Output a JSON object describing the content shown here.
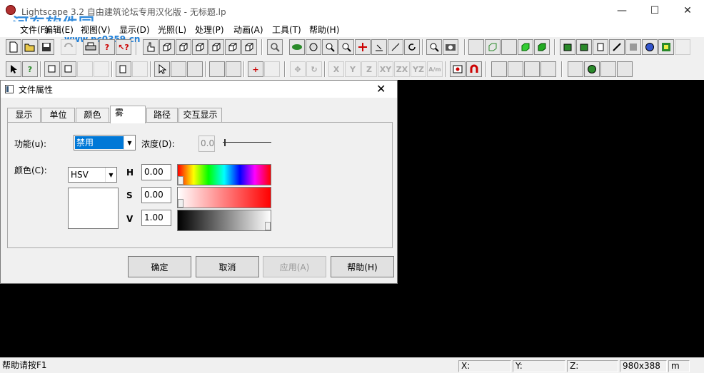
{
  "window": {
    "title": "Lightscape 3.2 自由建筑论坛专用汉化版  - 无标题.lp",
    "watermark": "河东软件园",
    "watermark_url": "www.pc0359.cn",
    "minimize": "—",
    "maximize": "☐",
    "close": "✕"
  },
  "menubar": [
    "文件(F)",
    "编辑(E)",
    "视图(V)",
    "显示(D)",
    "光照(L)",
    "处理(P)",
    "动画(A)",
    "工具(T)",
    "帮助(H)"
  ],
  "toolbar2_labels": {
    "x": "X",
    "y": "Y",
    "z": "Z",
    "xy": "XY",
    "zx": "ZX",
    "yz": "YZ",
    "aim": "A/m"
  },
  "dialog": {
    "title": "文件属性",
    "close": "✕",
    "tabs": [
      "显示",
      "单位",
      "颜色",
      "雾",
      "路径",
      "交互显示"
    ],
    "active_tab": "雾",
    "function_label": "功能(u):",
    "function_value": "禁用",
    "density_label": "浓度(D):",
    "density_value": "0.0",
    "density_level": 0.0,
    "color_label": "颜色(C):",
    "color_model": "HSV",
    "h_label": "H",
    "h_value": "0.00",
    "h_level": 0.0,
    "s_label": "S",
    "s_value": "0.00",
    "s_level": 0.0,
    "v_label": "V",
    "v_value": "1.00",
    "v_level": 1.0,
    "swatch_color": "#ffffff",
    "buttons": {
      "ok": "确定",
      "cancel": "取消",
      "apply": "应用(A)",
      "help": "帮助(H)"
    }
  },
  "statusbar": {
    "help": "帮助请按F1",
    "x": "X:",
    "y": "Y:",
    "z": "Z:",
    "size": "980x388",
    "unit": "m"
  }
}
